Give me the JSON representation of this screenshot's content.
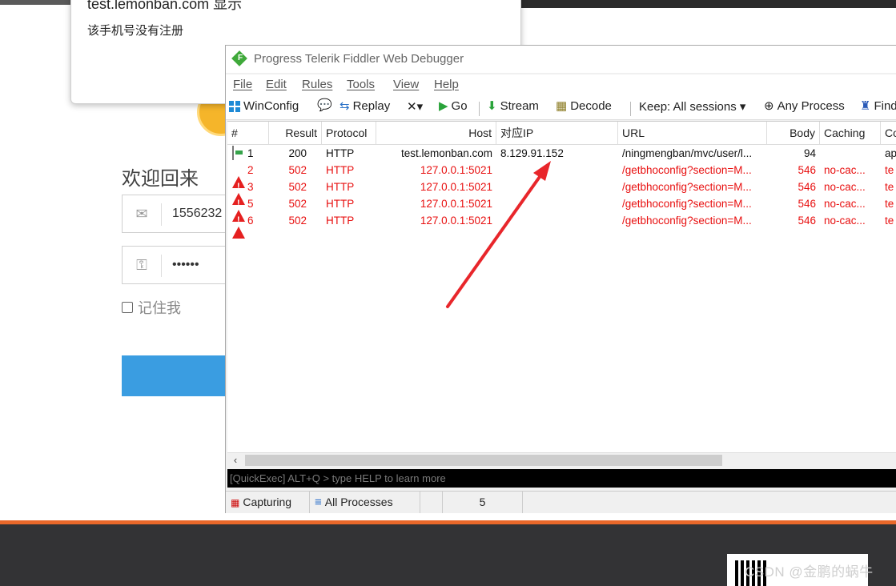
{
  "alert": {
    "title": "test.lemonban.com 显示",
    "message": "该手机号没有注册"
  },
  "login": {
    "welcome": "欢迎回来",
    "phone_value": "1556232",
    "password_value": "••••••",
    "remember_label": "记住我"
  },
  "fiddler": {
    "title": "Progress Telerik Fiddler Web Debugger",
    "menu": [
      "File",
      "Edit",
      "Rules",
      "Tools",
      "View",
      "Help"
    ],
    "toolbar": {
      "winconfig": "WinConfig",
      "replay": "Replay",
      "remove": "✕▾",
      "go": "Go",
      "stream": "Stream",
      "decode": "Decode",
      "keep": "Keep: All sessions ▾",
      "any_process": "Any Process",
      "find": "Find"
    },
    "columns": [
      "#",
      "Result",
      "Protocol",
      "Host",
      "对应IP",
      "URL",
      "Body",
      "Caching",
      "Co"
    ],
    "sessions": [
      {
        "id": "1",
        "result": "200",
        "protocol": "HTTP",
        "host": "test.lemonban.com",
        "ip": "8.129.91.152",
        "url": "/ningmengban/mvc/user/l...",
        "body": "94",
        "caching": "",
        "content": "ap",
        "status": "ok"
      },
      {
        "id": "2",
        "result": "502",
        "protocol": "HTTP",
        "host": "127.0.0.1:5021",
        "ip": "",
        "url": "/getbhoconfig?section=M...",
        "body": "546",
        "caching": "no-cac...",
        "content": "te",
        "status": "error"
      },
      {
        "id": "3",
        "result": "502",
        "protocol": "HTTP",
        "host": "127.0.0.1:5021",
        "ip": "",
        "url": "/getbhoconfig?section=M...",
        "body": "546",
        "caching": "no-cac...",
        "content": "te",
        "status": "error"
      },
      {
        "id": "5",
        "result": "502",
        "protocol": "HTTP",
        "host": "127.0.0.1:5021",
        "ip": "",
        "url": "/getbhoconfig?section=M...",
        "body": "546",
        "caching": "no-cac...",
        "content": "te",
        "status": "error"
      },
      {
        "id": "6",
        "result": "502",
        "protocol": "HTTP",
        "host": "127.0.0.1:5021",
        "ip": "",
        "url": "/getbhoconfig?section=M...",
        "body": "546",
        "caching": "no-cac...",
        "content": "te",
        "status": "error"
      }
    ],
    "quickexec_placeholder": "[QuickExec] ALT+Q > type HELP to learn more",
    "status": {
      "capturing": "Capturing",
      "processes": "All Processes",
      "session_count": "5"
    }
  },
  "watermark": "CSDN @金鹏的蜗牛",
  "colors": {
    "error_text": "#e81010",
    "annotation_arrow": "#e8262b",
    "footer_accent": "#e9682a",
    "login_button": "#3a9de1"
  }
}
